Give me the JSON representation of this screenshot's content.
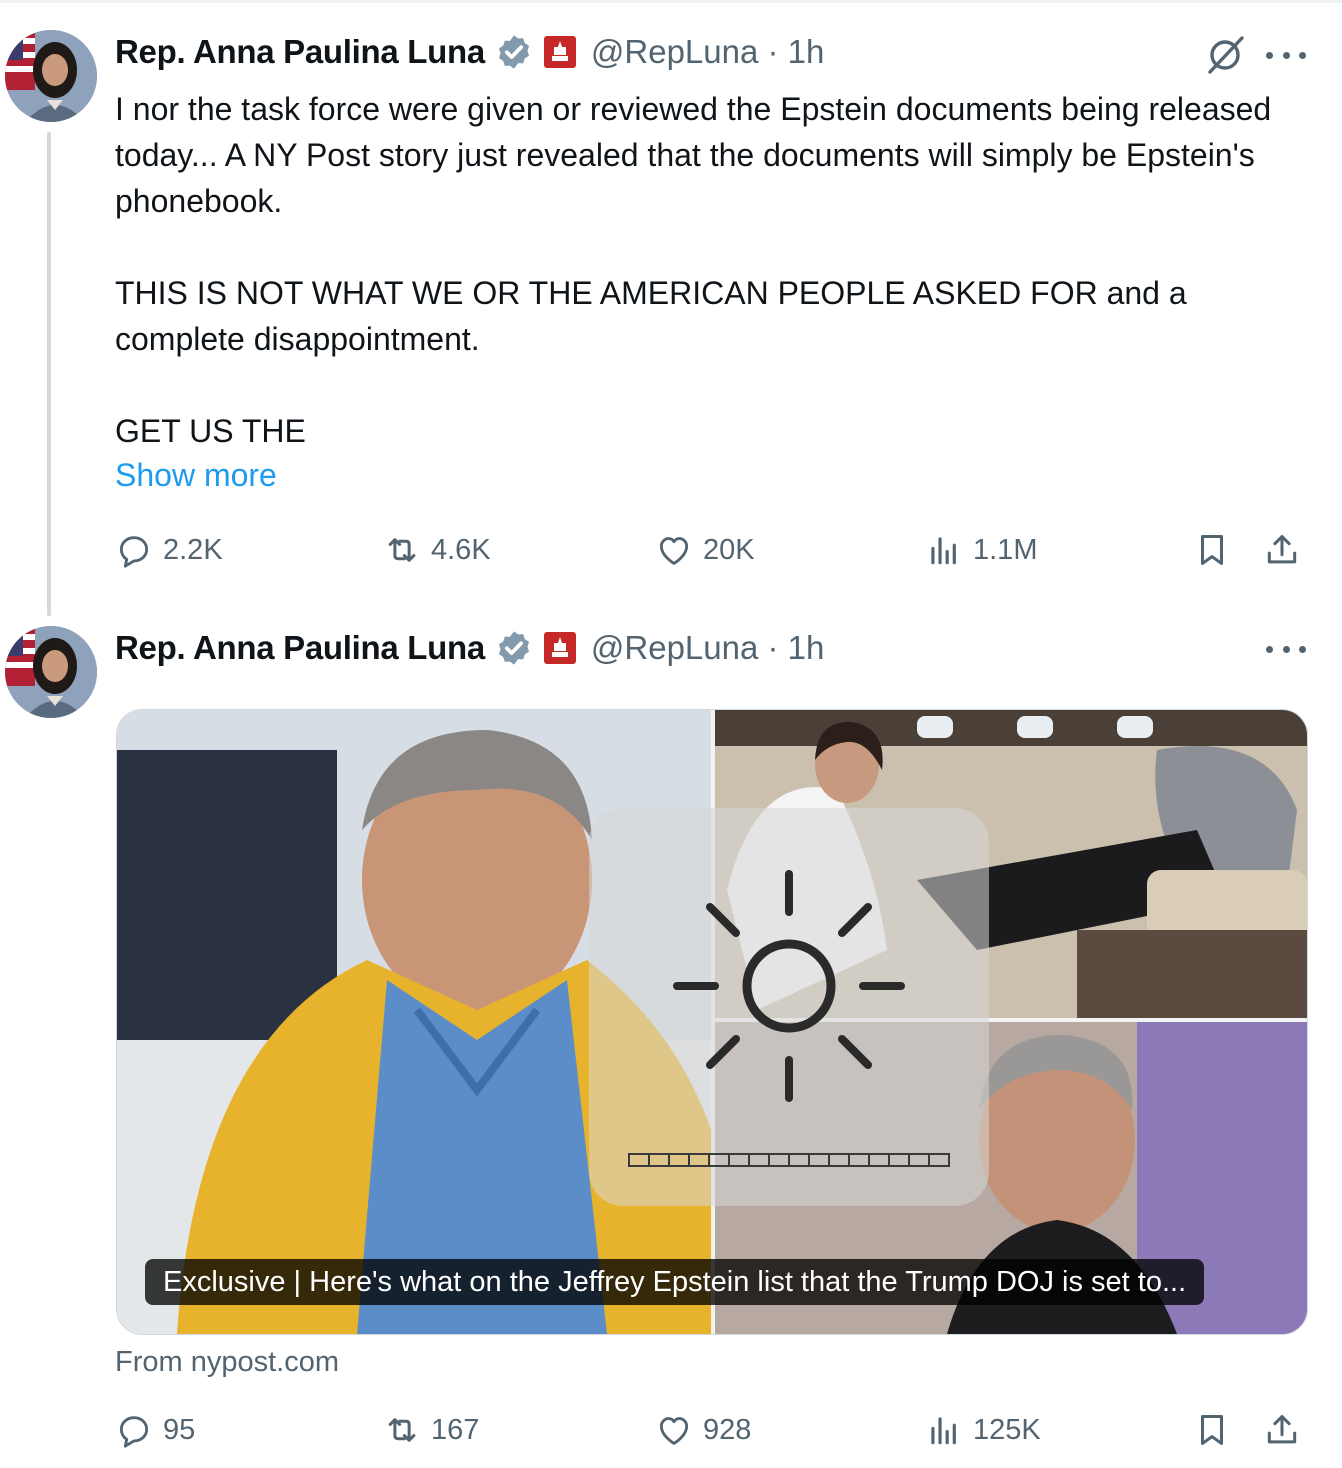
{
  "colors": {
    "text": "#0f1419",
    "secondary": "#536471",
    "link": "#1d9bf0",
    "verified_badge": "#829aab",
    "flag_badge": "#c62828"
  },
  "tweets": [
    {
      "author_name": "Rep. Anna Paulina Luna",
      "handle_time": "@RepLuna · 1h",
      "icons": [
        "grok-icon",
        "more-icon"
      ],
      "paragraphs": [
        "I nor the task force were given or reviewed the Epstein documents being released today... A NY Post story just revealed that the documents will simply be Epstein's phonebook.",
        "THIS IS NOT WHAT WE OR THE AMERICAN PEOPLE ASKED FOR and a complete disappointment.",
        "GET US THE"
      ],
      "show_more": "Show more",
      "stats": {
        "replies": "2.2K",
        "reposts": "4.6K",
        "likes": "20K",
        "views": "1.1M"
      }
    },
    {
      "author_name": "Rep. Anna Paulina Luna",
      "handle_time": "@RepLuna · 1h",
      "card": {
        "caption": "Exclusive | Here's what on the Jeffrey Epstein list that the Trump DOJ is set to...",
        "source": "From nypost.com"
      },
      "stats": {
        "replies": "95",
        "reposts": "167",
        "likes": "928",
        "views": "125K"
      }
    }
  ]
}
